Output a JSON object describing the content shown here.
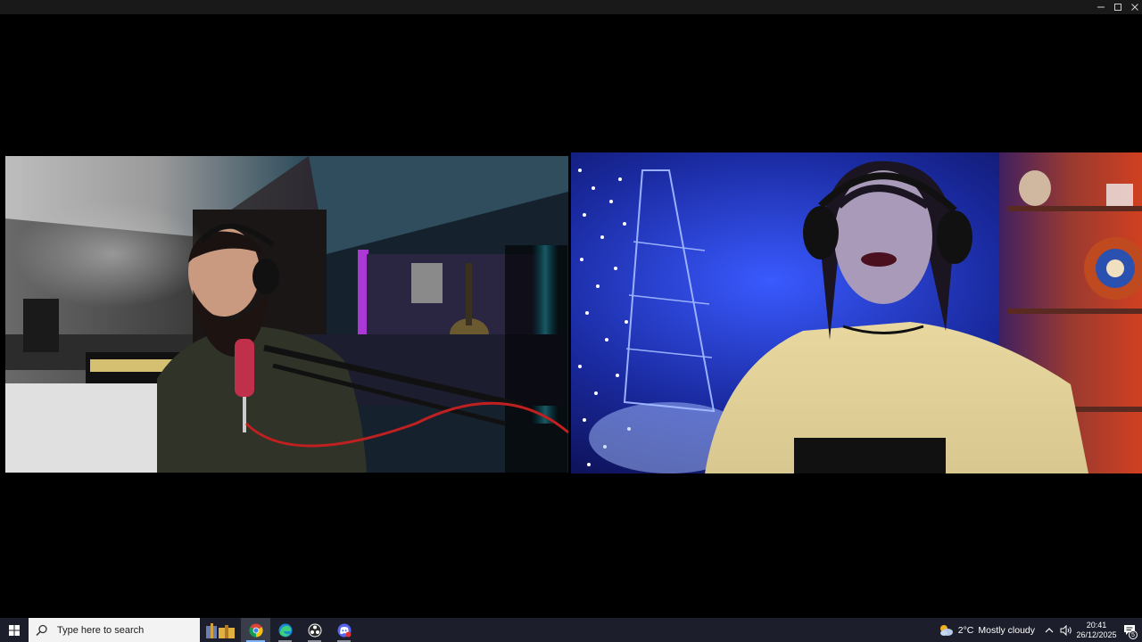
{
  "window": {
    "controls": [
      "minimize",
      "maximize",
      "close"
    ]
  },
  "video_tiles": [
    {
      "participant": "left-participant",
      "description_icon": "video-feed"
    },
    {
      "participant": "right-participant",
      "description_icon": "video-feed"
    }
  ],
  "taskbar": {
    "search_placeholder": "Type here to search",
    "pinned_apps": [
      {
        "icon": "widgets-gift-icon"
      },
      {
        "icon": "chrome-icon",
        "active": true
      },
      {
        "icon": "edge-icon"
      },
      {
        "icon": "obs-icon"
      },
      {
        "icon": "discord-icon"
      }
    ],
    "weather": {
      "temperature": "2°C",
      "condition": "Mostly cloudy"
    },
    "clock": {
      "time": "20:41",
      "date": "26/12/2025"
    },
    "notification_count": "5"
  }
}
